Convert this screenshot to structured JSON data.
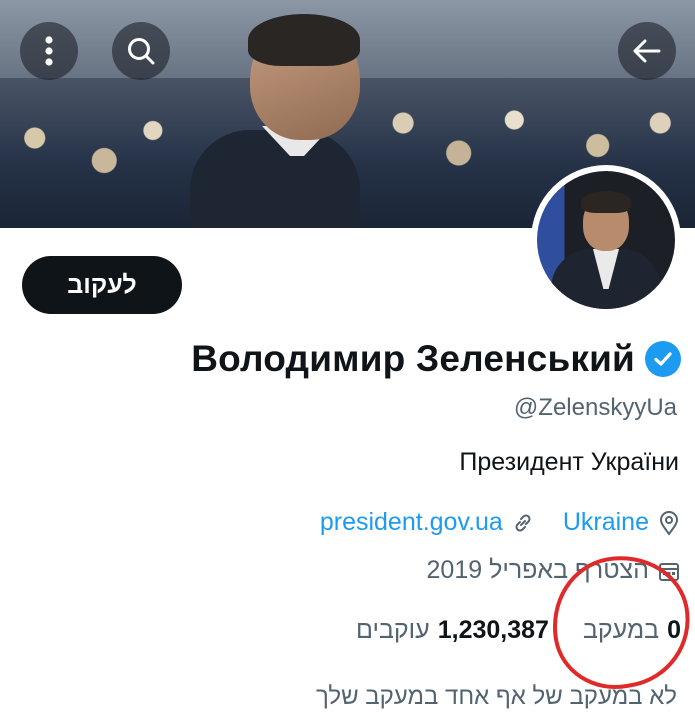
{
  "banner": {
    "icons": [
      "more-vertical-icon",
      "search-icon",
      "arrow-left-icon"
    ]
  },
  "profile": {
    "follow_label": "לעקוב",
    "display_name": "Володимир Зеленський",
    "verified": true,
    "handle": "@ZelenskyyUa",
    "bio": "Президент України",
    "website": "president.gov.ua",
    "location": "Ukraine",
    "joined": "הצטרף באפריל 2019",
    "following_count": "0",
    "following_label": "במעקב",
    "followers_count": "1,230,387",
    "followers_label": "עוקבים",
    "mutual_note": "לא במעקב של אף אחד במעקב שלך"
  },
  "colors": {
    "accent": "#1d9bf0",
    "text": "#0f1419",
    "muted": "#536471",
    "annotation": "#e02a2a"
  }
}
